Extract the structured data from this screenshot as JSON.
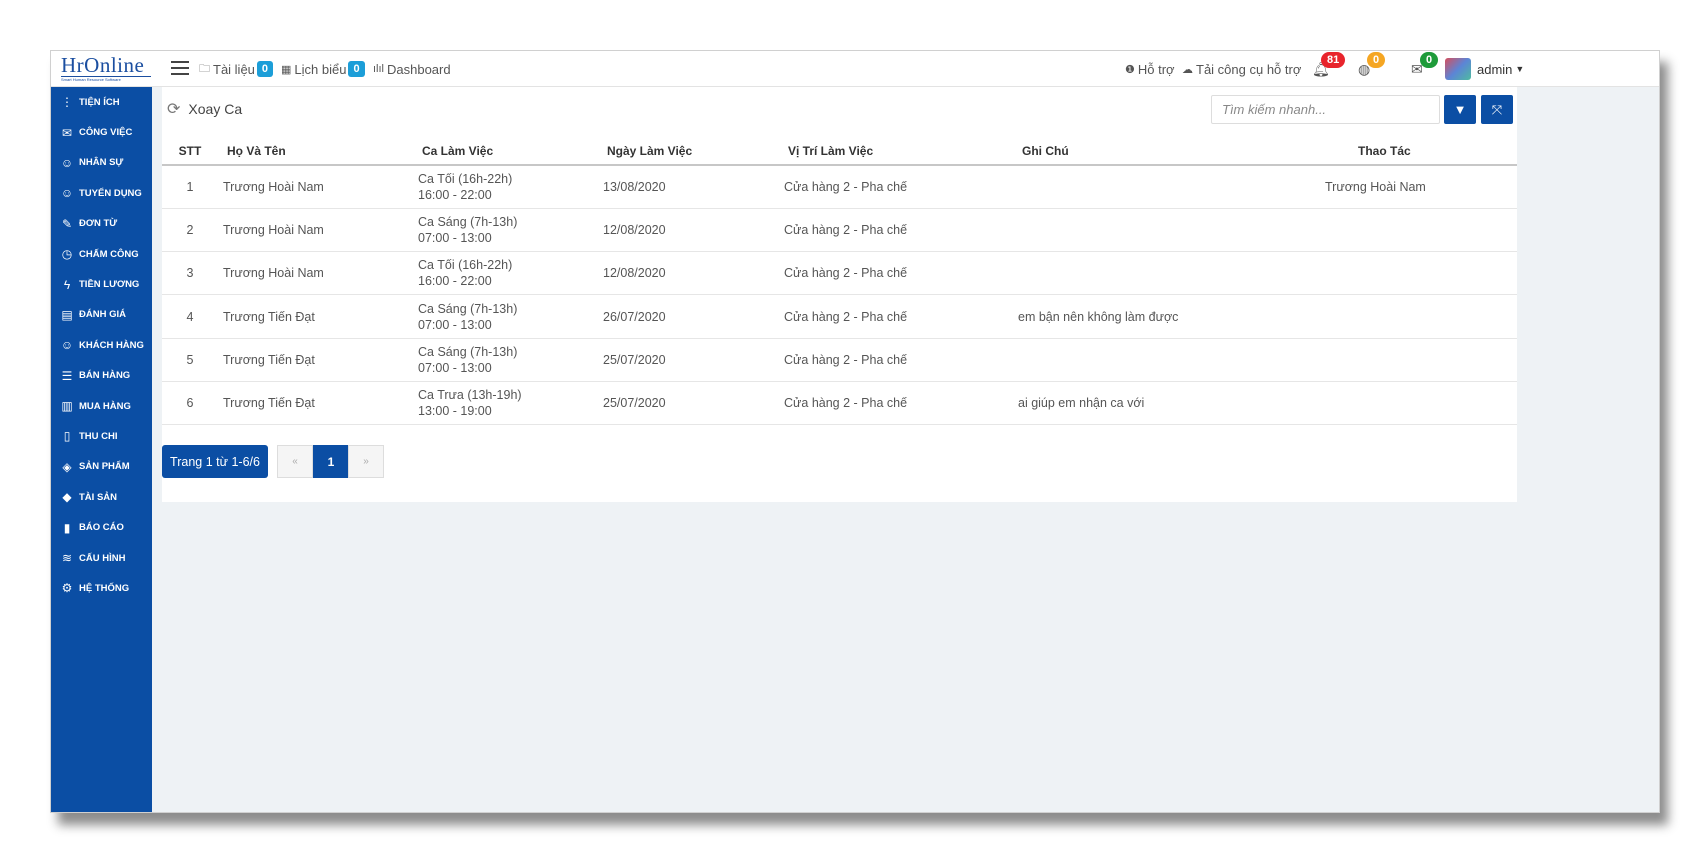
{
  "app": {
    "logo_name": "HrOnline",
    "logo_tagline": "Smart Human Resource Software"
  },
  "topnav": {
    "docs": {
      "label": "Tài liệu",
      "count": "0"
    },
    "schedule": {
      "label": "Lịch biểu",
      "count": "0"
    },
    "dashboard": {
      "label": "Dashboard"
    },
    "support": {
      "label": "Hỗ trợ"
    },
    "download": {
      "label": "Tải công cụ hỗ trợ"
    },
    "notif_bell": "81",
    "notif_globe": "0",
    "notif_mail": "0",
    "user": "admin",
    "colors": {
      "red": "#e8242c",
      "orange": "#f5a623",
      "green": "#1e9b3a"
    }
  },
  "sidebar": {
    "items": [
      {
        "label": "TIỆN ÍCH",
        "icon": "dots-vertical-icon"
      },
      {
        "label": "CÔNG VIỆC",
        "icon": "envelope-icon"
      },
      {
        "label": "NHÂN SỰ",
        "icon": "user-icon"
      },
      {
        "label": "TUYỂN DỤNG",
        "icon": "user-icon"
      },
      {
        "label": "ĐƠN TỪ",
        "icon": "edit-icon"
      },
      {
        "label": "CHẤM CÔNG",
        "icon": "clock-icon"
      },
      {
        "label": "TIỀN LƯƠNG",
        "icon": "bolt-icon"
      },
      {
        "label": "ĐÁNH GIÁ",
        "icon": "book-icon"
      },
      {
        "label": "KHÁCH HÀNG",
        "icon": "user-icon"
      },
      {
        "label": "BÁN HÀNG",
        "icon": "list-icon"
      },
      {
        "label": "MUA HÀNG",
        "icon": "map-icon"
      },
      {
        "label": "THU CHI",
        "icon": "file-icon"
      },
      {
        "label": "SẢN PHẨM",
        "icon": "tag-icon"
      },
      {
        "label": "TÀI SẢN",
        "icon": "diamond-icon"
      },
      {
        "label": "BÁO CÁO",
        "icon": "bar-chart-icon"
      },
      {
        "label": "CẤU HÌNH",
        "icon": "layers-icon"
      },
      {
        "label": "HỆ THỐNG",
        "icon": "gear-icon"
      }
    ]
  },
  "main": {
    "title": "Xoay Ca",
    "search_placeholder": "Tìm kiếm nhanh...",
    "columns": [
      "STT",
      "Họ Và Tên",
      "Ca Làm Việc",
      "Ngày Làm Việc",
      "Vị Trí Làm Việc",
      "Ghi Chú",
      "Thao Tác"
    ],
    "rows": [
      {
        "stt": "1",
        "name": "Trương Hoài Nam",
        "shift": "Ca Tối (16h-22h)",
        "time": "16:00 - 22:00",
        "date": "13/08/2020",
        "location": "Cửa hàng 2 - Pha chế",
        "note": "",
        "action": "Trương Hoài Nam"
      },
      {
        "stt": "2",
        "name": "Trương Hoài Nam",
        "shift": "Ca Sáng (7h-13h)",
        "time": "07:00 - 13:00",
        "date": "12/08/2020",
        "location": "Cửa hàng 2 - Pha chế",
        "note": "",
        "action": ""
      },
      {
        "stt": "3",
        "name": "Trương Hoài Nam",
        "shift": "Ca Tối (16h-22h)",
        "time": "16:00 - 22:00",
        "date": "12/08/2020",
        "location": "Cửa hàng 2 - Pha chế",
        "note": "",
        "action": ""
      },
      {
        "stt": "4",
        "name": "Trương Tiến Đạt",
        "shift": "Ca Sáng (7h-13h)",
        "time": "07:00 - 13:00",
        "date": "26/07/2020",
        "location": "Cửa hàng 2 - Pha chế",
        "note": "em bận nên không làm được",
        "action": ""
      },
      {
        "stt": "5",
        "name": "Trương Tiến Đạt",
        "shift": "Ca Sáng (7h-13h)",
        "time": "07:00 - 13:00",
        "date": "25/07/2020",
        "location": "Cửa hàng 2 - Pha chế",
        "note": "",
        "action": ""
      },
      {
        "stt": "6",
        "name": "Trương Tiến Đạt",
        "shift": "Ca Trưa (13h-19h)",
        "time": "13:00 - 19:00",
        "date": "25/07/2020",
        "location": "Cửa hàng 2 - Pha chế",
        "note": "ai giúp em nhận ca với",
        "action": ""
      }
    ],
    "pagination": {
      "info": "Trang 1 từ 1-6/6",
      "prev": "«",
      "current": "1",
      "next": "»"
    }
  }
}
